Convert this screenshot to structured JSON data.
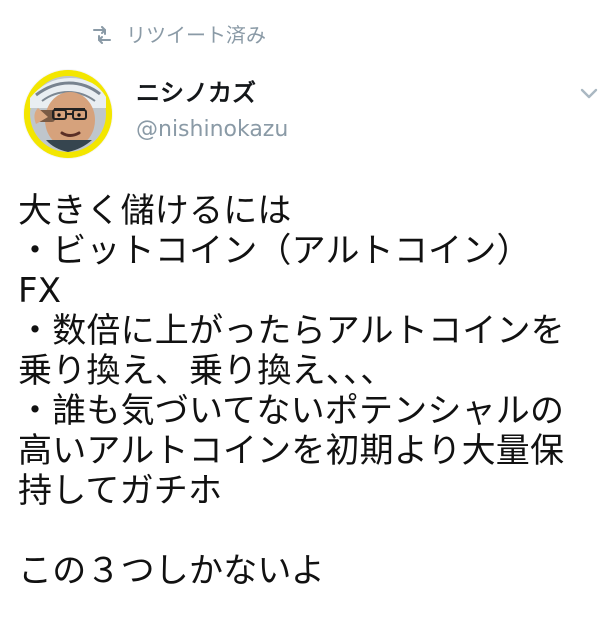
{
  "retweet": {
    "label": "リツイート済み",
    "icon": "retweet-icon"
  },
  "user": {
    "display_name": "ニシノカズ",
    "handle": "@nishinokazu",
    "avatar_icon": "profile-avatar"
  },
  "menu": {
    "icon": "chevron-down-icon"
  },
  "tweet": {
    "lines": [
      "大きく儲けるには",
      "・ビットコイン（アルトコイン）",
      "FX",
      "・数倍に上がったらアルトコインを",
      "乗り換え、乗り換え、、、",
      "・誰も気づいてないポテンシャルの",
      "高いアルトコインを初期より大量保",
      "持してガチホ",
      "",
      "この３つしかないよ"
    ]
  },
  "colors": {
    "muted": "#8a9aa6",
    "text": "#111111",
    "avatar_ring": "#f3e600"
  }
}
